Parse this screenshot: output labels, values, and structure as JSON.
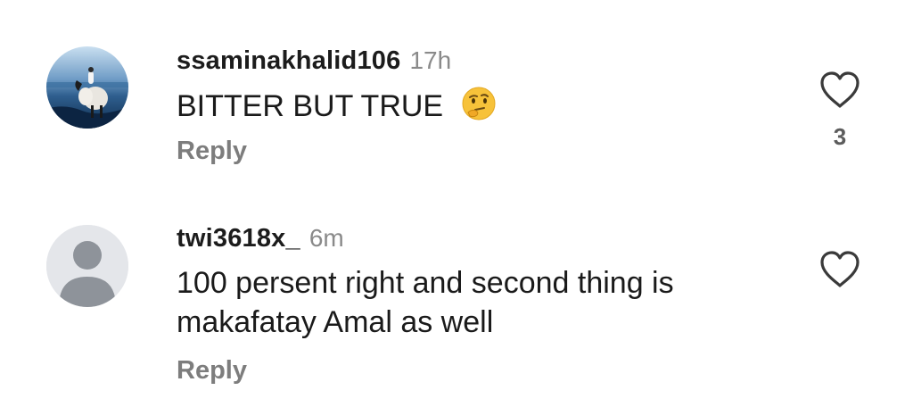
{
  "comments": [
    {
      "username": "ssaminakhalid106",
      "time": "17h",
      "text": "BITTER BUT TRUE",
      "emoji": "thinking-face",
      "reply_label": "Reply",
      "like_count": "3",
      "avatar": "profile-photo"
    },
    {
      "username": "twi3618x_",
      "time": "6m",
      "text_lines": [
        "100 persent right and second thing is",
        "makafatay Amal as well"
      ],
      "reply_label": "Reply",
      "avatar": "default-avatar"
    }
  ],
  "colors": {
    "username": "#1c1c1c",
    "time": "#8a8a8a",
    "reply": "#7d7d7d",
    "heart_outline": "#3a3a3a",
    "default_avatar_bg": "#e4e6ea",
    "default_avatar_fg": "#8e939a"
  }
}
